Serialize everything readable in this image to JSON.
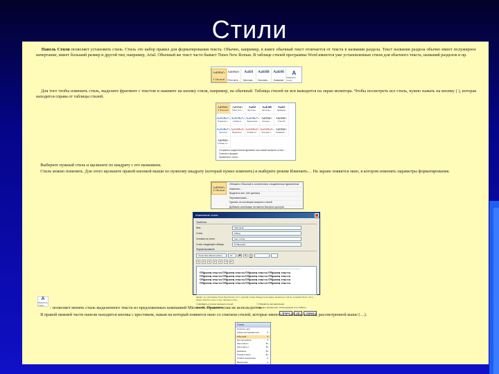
{
  "slide": {
    "title": "Стили"
  },
  "colors": {
    "background_top": "#02022a",
    "background_bottom": "#1010c8",
    "document_bg": "#fffbb8",
    "selection": "#fbe19a",
    "accent_bar": "#1f5ff0"
  },
  "doc": {
    "p1_lead": "Панель Стили",
    "p1_text": "позволяет установить стиль. Стиль это набор правил для форматирования текста. Обычно, например, в книге обычный текст отличается от текста в названии раздела. Текст названия раздела обычно имеет полужирное начертание, имеет больший размер и другой тип, например, Arial. Обычный же текст часто бывает Times New Roman. В таблице стилей программы Word имеются уже установленные стили для обычного текста, названий разделов и пр.",
    "p2_text": "Для того чтобы изменить стиль, выделите фрагмент с текстом и нажмите на кнопку стиля, например, на обычный. Таблица стилей не вся выводится на экран монитора. Чтобы посмотреть все стиль, нужно нажать на кнопку (  ), которая находится справа от таблицы стилей.",
    "p3_text": "Выберите нужный стиль и щелкните по квадрату с его названием.",
    "p4_text": "Стиль можно поменять. Для этого щелкните правой кнопкой мыши по нужному квадрату (который нужно изменить) и выберите режим Изменить… На экране появится окно, в котором изменять параметры форматирования.",
    "p5_text": "- позволяет менять стиль выделенного текста из предложенных компанией Microsoft. Практически не используется.",
    "p6_text": "В правой нижней части панели находится кнопка с крестиком, нажав на который появится окно со списком стилей, которые имеются в таблице стилей, рассмотренной выше (…)."
  },
  "ribbon_strip": {
    "items": [
      {
        "sample": "АаБбВвГг",
        "name": "¶ Обычный",
        "selected": true
      },
      {
        "sample": "АаБбВвГг",
        "name": "¶ Без инте...",
        "selected": false
      },
      {
        "sample": "АаБб",
        "name": "Заголово...",
        "selected": false
      },
      {
        "sample": "АаБбВ",
        "name": "Заголово...",
        "selected": false
      },
      {
        "sample": "АаБбб",
        "name": "Название",
        "selected": false
      }
    ],
    "change_label": "Изменить стили"
  },
  "gallery": {
    "rows": [
      [
        {
          "s": "АаБбВвГг",
          "n": "¶ Обычный",
          "k": "n",
          "sel": true
        },
        {
          "s": "АаБбВвГг",
          "n": "¶ Без инте...",
          "k": "n"
        },
        {
          "s": "АаБб",
          "n": "Заголово...",
          "k": ""
        },
        {
          "s": "АаБбВ",
          "n": "Заголово...",
          "k": ""
        },
        {
          "s": "АаБб",
          "n": "Название",
          "k": ""
        }
      ],
      [
        {
          "s": "АаБбВвГг",
          "n": "Подзаголо...",
          "k": "blue"
        },
        {
          "s": "АаБбВвГг",
          "n": "Слабое в...",
          "k": "blue"
        },
        {
          "s": "АаБбВвГг",
          "n": "Выделение",
          "k": "blue"
        },
        {
          "s": "АаБбВвГг",
          "n": "Сильное ...",
          "k": "n"
        },
        {
          "s": "АаБбВвГг",
          "n": "Строгий",
          "k": "n"
        }
      ],
      [
        {
          "s": "АаБбВвГг",
          "n": "Цитата 2",
          "k": "blue"
        },
        {
          "s": "АаБбВвГг",
          "n": "Выделенн...",
          "k": "red"
        },
        {
          "s": "АаБбВвГг",
          "n": "Слабая сс...",
          "k": "red"
        },
        {
          "s": "АаБбВвГг",
          "n": "Сильная с...",
          "k": "red"
        },
        {
          "s": "АаБбВвГг",
          "n": "Название ...",
          "k": "n"
        }
      ],
      [
        {
          "s": "АаБбВвГг",
          "n": "¶ Абзац сп...",
          "k": "n"
        }
      ]
    ],
    "menu": [
      "Сохранить выделенный фрагмент как новый экспресс-стиль...",
      "Очистить формат",
      "Применить стили..."
    ]
  },
  "context_menu": {
    "items": [
      "Обновить Обычный в соответствии с выделенным фрагментом",
      "Изменить...",
      "Выделить все: (нет данных)",
      "Переименовать...",
      "Удалить из коллекции экспресс-стилей",
      "Добавить коллекцию на панель быстрого доступа"
    ]
  },
  "dialog": {
    "title": "Изменение стиля",
    "sec_props": "Свойства",
    "label_name": "Имя:",
    "value_name": "Обычный",
    "label_style": "Стиль:",
    "value_style": "Абзац",
    "label_based": "Основан на стиле:",
    "value_based": "(нет стиля)",
    "label_next": "Стиль следующего абзаца:",
    "value_next": "¶ Обычный",
    "sec_format": "Форматирование",
    "font": "Times New Roman (Осно",
    "size": "12",
    "preview_grey": "Предыдущий абзац Предыдущий абзац Предыдущий абзац Предыдущий абзац Предыдущий абзац Предыдущий абзац",
    "sample_line1": "Образец текста Образец текста Образец текста Образец текста",
    "sample_line2": "Образец текста Образец текста Образец текста Образец текста",
    "sample_line3": "Образец текста Образец текста Образец текста Образец текста",
    "sample_line4": "Образец текста Образец текста Образец текста Образец текста",
    "description": "Шрифт: (по умолчанию) Times New Roman, 12 пт, русский, Слева, Междустр.интервал: множитель 1,15 ин, интервал После: 10 пт, Запрет висячих строк, Стиль: Экспресс-стиль",
    "chk1": "Добавить в список экспресс-стилей",
    "chk2": "Обновлять автоматически",
    "chk3": "Только в этом документе",
    "chk4": "В новых документах, использующих этот шаблон",
    "btn_format": "Формат",
    "btn_ok": "ОК",
    "btn_cancel": "Отмена"
  },
  "icon_box": {
    "label": "Изменить стили"
  },
  "styles_pane": {
    "title": "Стили",
    "items": [
      {
        "name": "Очистить все",
        "mark": ""
      },
      {
        "name": "Абзац последовательн",
        "mark": "¶"
      },
      {
        "name": "Обычный",
        "mark": "¶",
        "sel": true
      },
      {
        "name": "Без интервала",
        "mark": "¶"
      },
      {
        "name": "Заголовок 1",
        "mark": "¶a"
      },
      {
        "name": "Заголовок 2",
        "mark": "¶a"
      },
      {
        "name": "Название",
        "mark": "¶a"
      },
      {
        "name": "Подзаголовок",
        "mark": "¶a"
      },
      {
        "name": "Слабое выделение",
        "mark": "a"
      },
      {
        "name": "Выделение",
        "mark": "a"
      },
      {
        "name": "Сильное выделение",
        "mark": "a"
      }
    ]
  }
}
